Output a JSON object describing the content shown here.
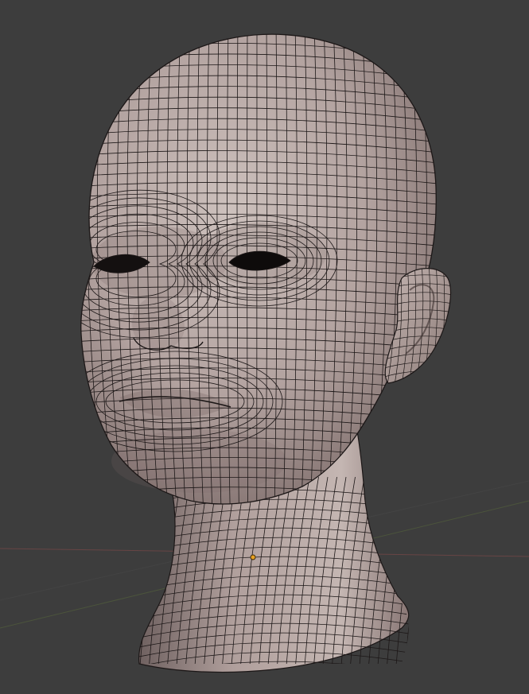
{
  "viewport": {
    "mode": "3D viewport",
    "shading": "solid",
    "overlay_wireframe": true,
    "object_origin_marker": "origin-dot"
  },
  "colors": {
    "background": "#3d3d3d",
    "grid_line": "#4a4a4a",
    "x_axis": "#7a4848",
    "y_axis": "#5a6b3c",
    "skin_light": "#c9bcb8",
    "skin_mid": "#a89694",
    "skin_dark": "#6e5f5e",
    "wire": "#1c1717",
    "origin": "#e8a020"
  },
  "object": {
    "type": "head-mesh"
  }
}
